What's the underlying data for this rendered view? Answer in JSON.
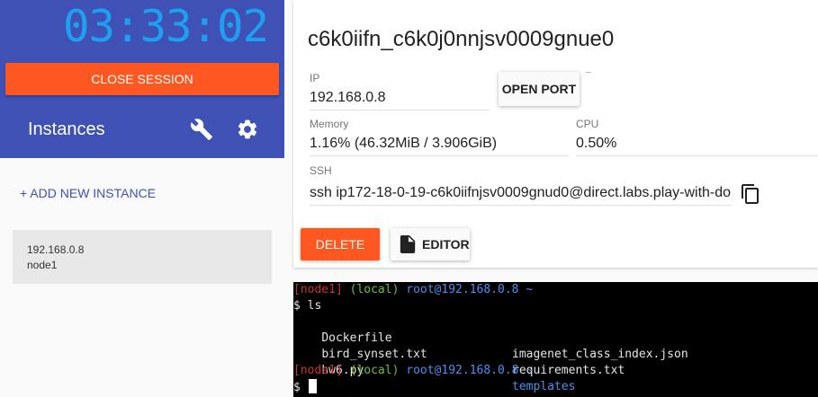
{
  "sidebar": {
    "timer": "03:33:02",
    "close_session_label": "CLOSE SESSION",
    "instances_title": "Instances",
    "add_instance_label": "+ ADD NEW INSTANCE",
    "instances": [
      {
        "ip": "192.168.0.8",
        "hostname": "node1"
      }
    ]
  },
  "session": {
    "title": "c6k0iifn_c6k0j0nnjsv0009gnue0",
    "ip_label": "IP",
    "ip_value": "192.168.0.8",
    "open_port_label": "OPEN PORT",
    "memory_label": "Memory",
    "memory_value": "1.16% (46.32MiB / 3.906GiB)",
    "cpu_label": "CPU",
    "cpu_value": "0.50%",
    "ssh_label": "SSH",
    "ssh_value": "ssh ip172-18-0-19-c6k0iifnjsv0009gnud0@direct.labs.play-with-do",
    "delete_label": "DELETE",
    "editor_label": "EDITOR"
  },
  "terminal": {
    "prompt_node": "[node1]",
    "prompt_local": "(local)",
    "prompt_user": "root@192.168.0.8",
    "prompt_dir": "~",
    "command": "$ ls",
    "files_col1": [
      "Dockerfile",
      "bird_synset.txt",
      "hw6.py"
    ],
    "files_col2": [
      "imagenet_class_index.json",
      "requirements.txt",
      "templates"
    ],
    "final_prompt": "$",
    "colors": {
      "node": "#cd3131",
      "local": "#6fc21f",
      "user": "#4a8ff0",
      "dir_listing": "#4a8ff0"
    }
  },
  "colors": {
    "header": "#3f51b5",
    "accent": "#ff5722",
    "timer": "#1e9ff0"
  },
  "icons": [
    "wrench-icon",
    "gear-icon",
    "copy-icon",
    "file-icon"
  ]
}
